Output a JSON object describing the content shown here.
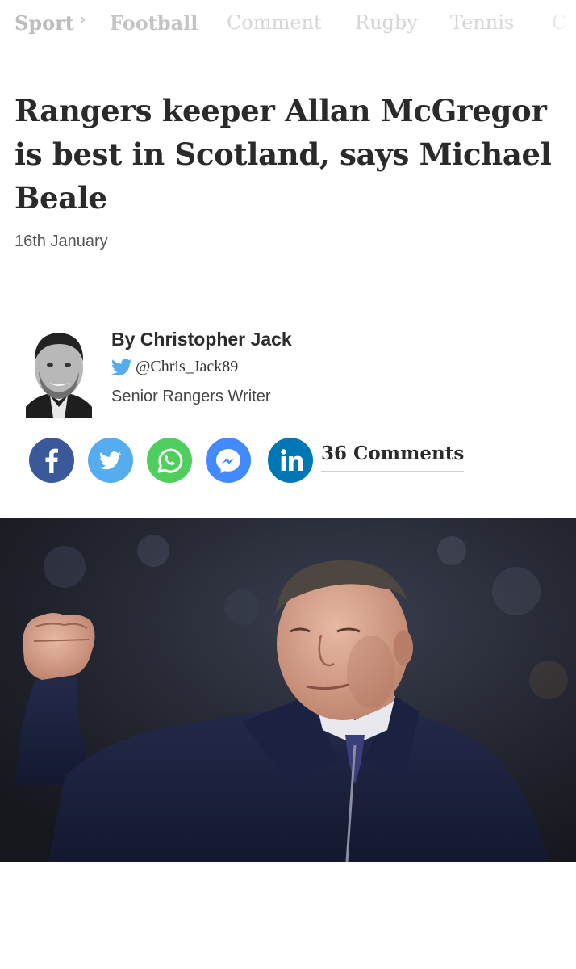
{
  "nav": {
    "section": "Sport",
    "items": [
      "Football",
      "Comment",
      "Rugby",
      "Tennis",
      "Cr"
    ]
  },
  "article": {
    "headline": "Rangers keeper Allan McGregor is best in Scotland, says Michael Beale",
    "date": "16th January"
  },
  "author": {
    "byline": "By Christopher Jack",
    "twitter": "@Chris_Jack89",
    "role": "Senior Rangers Writer"
  },
  "share": {
    "icons": [
      "facebook-icon",
      "twitter-icon",
      "whatsapp-icon",
      "messenger-icon",
      "linkedin-icon"
    ],
    "colors": {
      "facebook": "#3b5998",
      "twitter": "#55acee",
      "whatsapp": "#4fce5d",
      "messenger": "#448aff",
      "linkedin": "#0077b5"
    },
    "comments_label": "36 Comments"
  },
  "colors": {
    "headline": "#2a2a2a",
    "nav_inactive": "#d6d6d6"
  }
}
